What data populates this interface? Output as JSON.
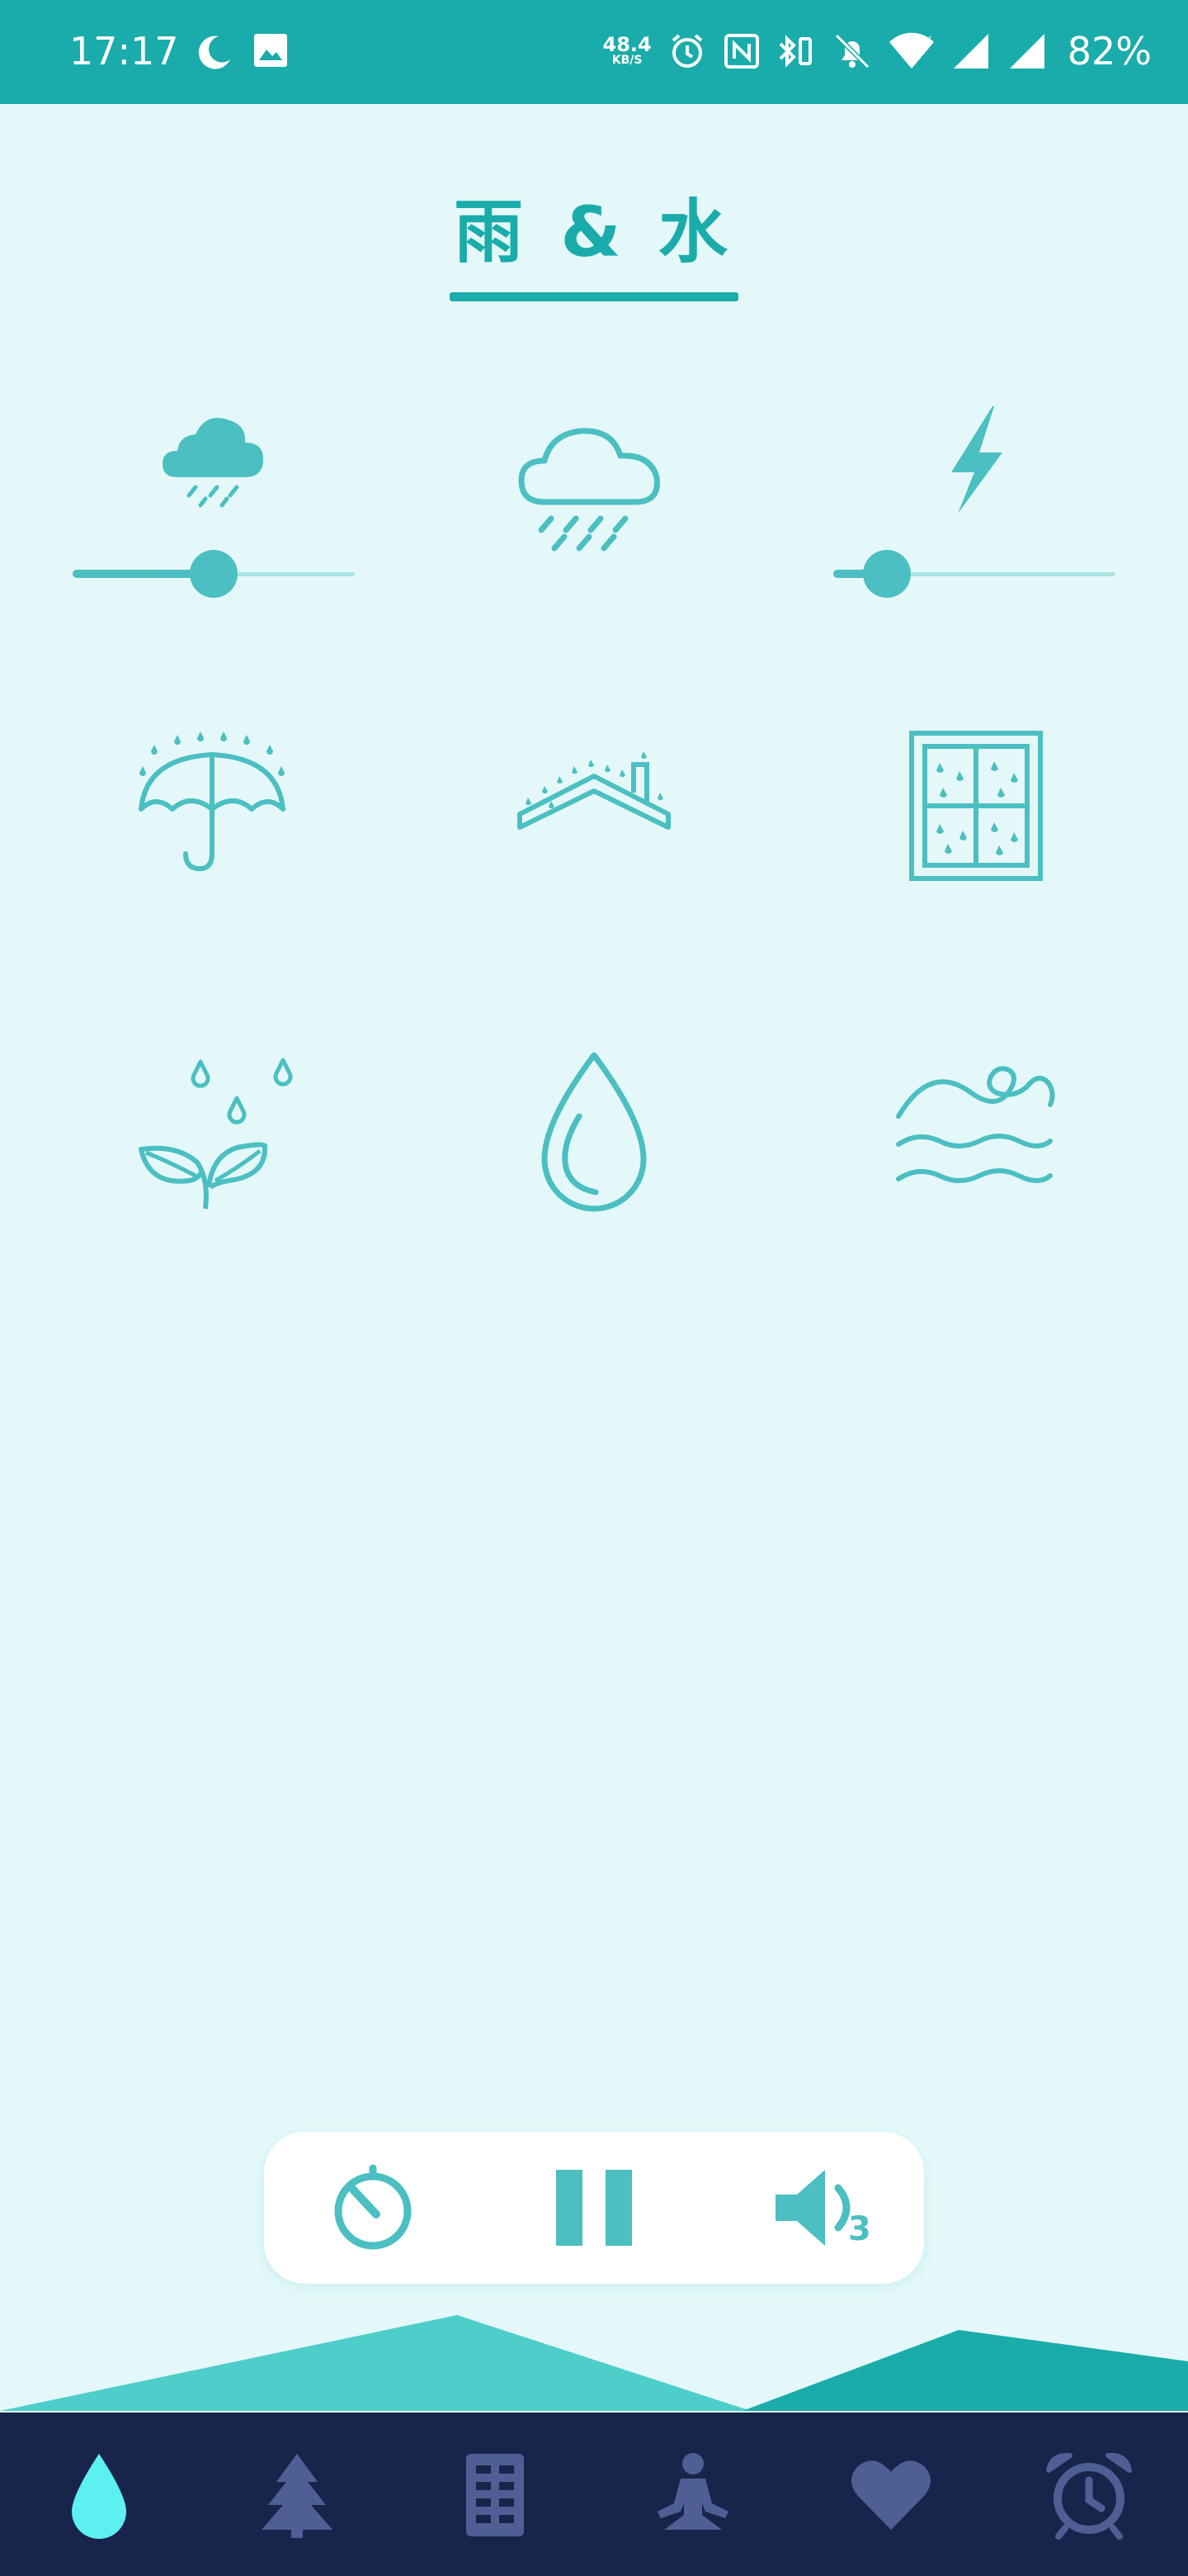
{
  "status_bar": {
    "time": "17:17",
    "net_speed_value": "48.4",
    "net_speed_unit": "KB/S",
    "battery_percent": "82%",
    "background_color": "#1AACAA"
  },
  "header": {
    "title": "雨 & 水"
  },
  "sounds": [
    {
      "name": "light-rain",
      "icon": "rain-cloud-icon",
      "active": true,
      "volume": 0.5
    },
    {
      "name": "heavy-rain",
      "icon": "cloud-heavy-rain-icon",
      "active": false
    },
    {
      "name": "thunder",
      "icon": "lightning-icon",
      "active": true,
      "volume": 0.19
    },
    {
      "name": "rain-on-umbrella",
      "icon": "umbrella-rain-icon",
      "active": false
    },
    {
      "name": "rain-on-roof",
      "icon": "roof-rain-icon",
      "active": false
    },
    {
      "name": "rain-on-window",
      "icon": "window-rain-icon",
      "active": false
    },
    {
      "name": "rain-on-leaves",
      "icon": "leaves-rain-icon",
      "active": false
    },
    {
      "name": "water-drops",
      "icon": "water-drop-icon",
      "active": false
    },
    {
      "name": "waves",
      "icon": "waves-icon",
      "active": false
    }
  ],
  "player": {
    "timer_icon": "timer-icon",
    "pause_icon": "pause-icon",
    "volume_icon": "volume-icon",
    "volume_level": "3"
  },
  "bottom_nav": {
    "items": [
      {
        "icon": "water-drop-icon",
        "active": true
      },
      {
        "icon": "pine-tree-icon",
        "active": false
      },
      {
        "icon": "building-icon",
        "active": false
      },
      {
        "icon": "meditation-icon",
        "active": false
      },
      {
        "icon": "heart-icon",
        "active": false
      },
      {
        "icon": "alarm-clock-icon",
        "active": false
      }
    ]
  },
  "colors": {
    "accent": "#1AACAA",
    "icon": "#4BBFC1",
    "background": "#E4F8F9",
    "nav_background": "#18254A",
    "nav_active": "#5CF0F1",
    "nav_inactive": "#4F5F96"
  }
}
